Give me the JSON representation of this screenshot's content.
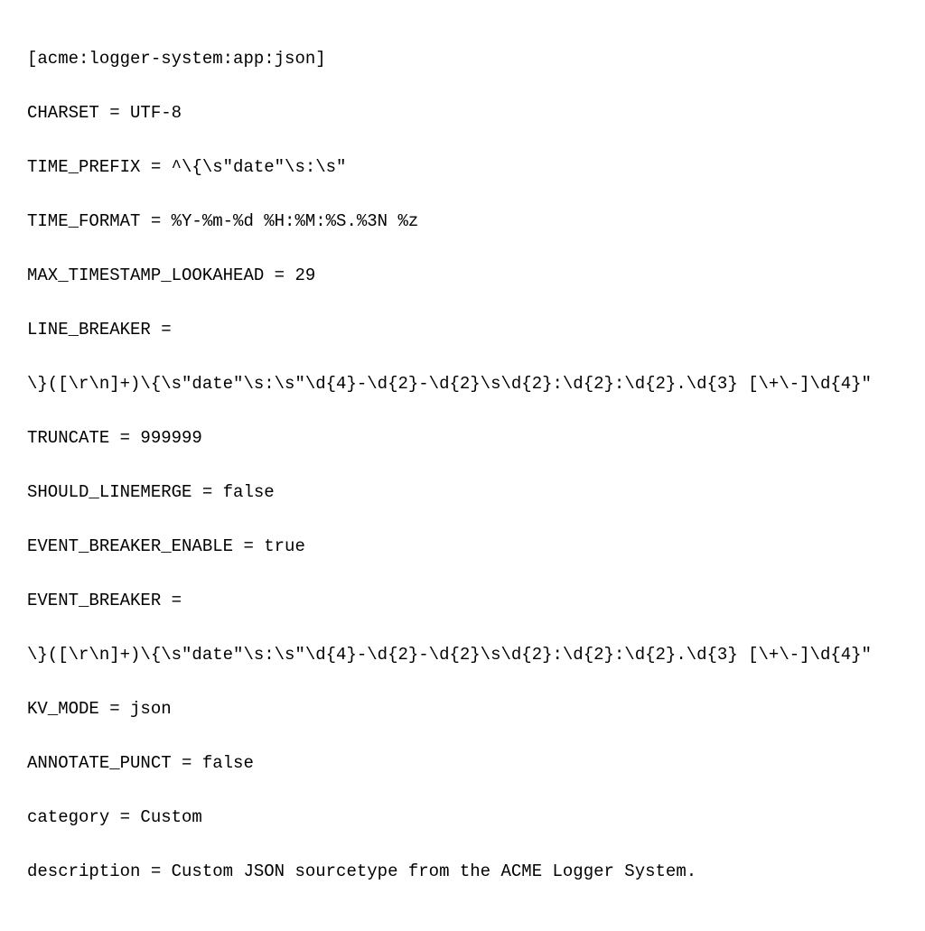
{
  "config": {
    "stanza": "[acme:logger-system:app:json]",
    "lines": [
      "CHARSET = UTF-8",
      "TIME_PREFIX = ^\\{\\s\"date\"\\s:\\s\"",
      "TIME_FORMAT = %Y-%m-%d %H:%M:%S.%3N %z",
      "MAX_TIMESTAMP_LOOKAHEAD = 29",
      "LINE_BREAKER =",
      "\\}([\\r\\n]+)\\{\\s\"date\"\\s:\\s\"\\d{4}-\\d{2}-\\d{2}\\s\\d{2}:\\d{2}:\\d{2}.\\d{3} [\\+\\-]\\d{4}\"",
      "TRUNCATE = 999999",
      "SHOULD_LINEMERGE = false",
      "EVENT_BREAKER_ENABLE = true",
      "EVENT_BREAKER =",
      "\\}([\\r\\n]+)\\{\\s\"date\"\\s:\\s\"\\d{4}-\\d{2}-\\d{2}\\s\\d{2}:\\d{2}:\\d{2}.\\d{3} [\\+\\-]\\d{4}\"",
      "KV_MODE = json",
      "ANNOTATE_PUNCT = false",
      "category = Custom",
      "description = Custom JSON sourcetype from the ACME Logger System."
    ]
  }
}
